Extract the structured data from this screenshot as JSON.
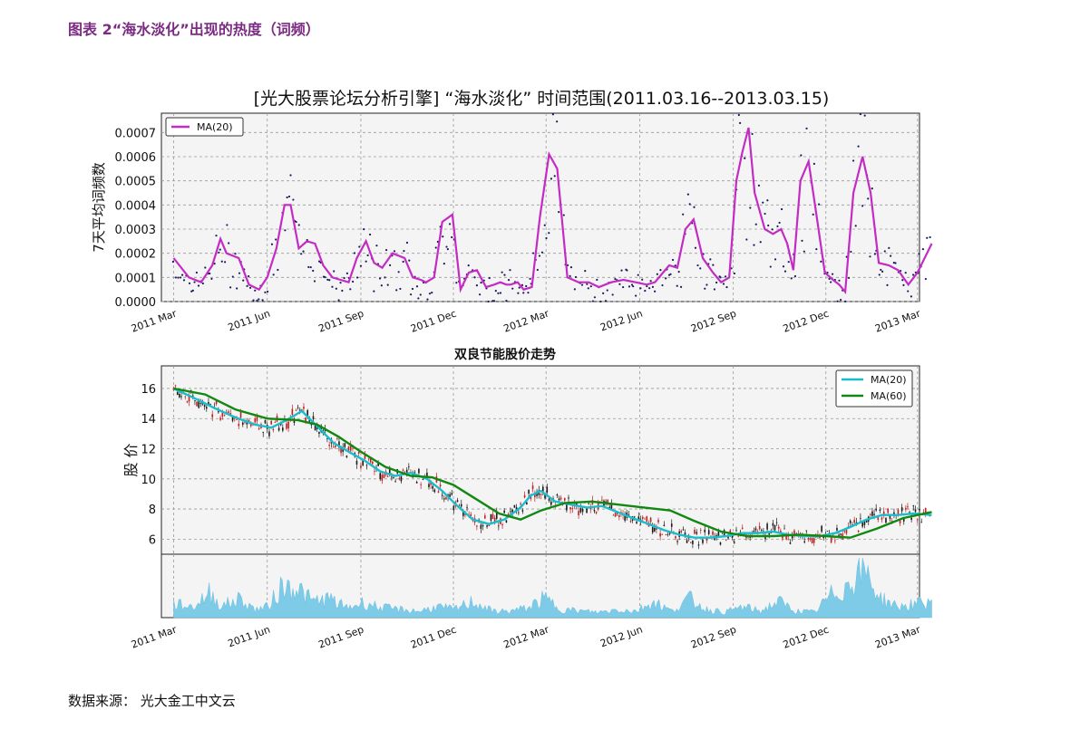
{
  "figure_title": "图表 2“海水淡化”出现的热度（词频）",
  "source": "数据来源：  光大金工中文云",
  "colors": {
    "title": "#7b2c82",
    "ma_word": "#c42bc4",
    "dots": "#1a1a5e",
    "ma20_price": "#1bbccc",
    "ma60_price": "#118811",
    "candle_up": "#c21f1f",
    "candle_down": "#1a1a1a",
    "volume": "#7ecbe8",
    "plot_bg": "#f4f4f4"
  },
  "chart_data": [
    {
      "type": "line",
      "title": "[光大股票论坛分析引擎] “海水淡化” 时间范围(2011.03.16--2013.03.15)",
      "ylabel": "7天平均词频数",
      "legend": [
        "MA(20)"
      ],
      "legend_position": "top-left",
      "grid": true,
      "x_range": [
        "2011-03-16",
        "2013-03-15"
      ],
      "x_ticks": [
        "2011 Mar",
        "2011 Jun",
        "2011 Sep",
        "2011 Dec",
        "2012 Mar",
        "2012 Jun",
        "2012 Sep",
        "2012 Dec",
        "2013 Mar"
      ],
      "y_ticks": [
        "0.0000",
        "0.0001",
        "0.0002",
        "0.0003",
        "0.0004",
        "0.0005",
        "0.0006",
        "0.0007"
      ],
      "ylim": [
        0,
        0.00078
      ],
      "series": [
        {
          "name": "MA(20)",
          "x": [
            "2011-03-01",
            "2011-03-16",
            "2011-03-28",
            "2011-04-08",
            "2011-04-16",
            "2011-04-22",
            "2011-05-04",
            "2011-05-14",
            "2011-05-24",
            "2011-06-01",
            "2011-06-10",
            "2011-06-18",
            "2011-06-24",
            "2011-07-02",
            "2011-07-10",
            "2011-07-18",
            "2011-07-26",
            "2011-08-04",
            "2011-08-12",
            "2011-08-20",
            "2011-08-28",
            "2011-09-06",
            "2011-09-14",
            "2011-09-22",
            "2011-10-02",
            "2011-10-14",
            "2011-10-22",
            "2011-10-30",
            "2011-11-04",
            "2011-11-12",
            "2011-11-20",
            "2011-11-30",
            "2011-12-08",
            "2011-12-16",
            "2011-12-24",
            "2012-01-02",
            "2012-01-10",
            "2012-01-16",
            "2012-01-22",
            "2012-01-26",
            "2012-02-02",
            "2012-02-08",
            "2012-02-16",
            "2012-02-24",
            "2012-03-04",
            "2012-03-12",
            "2012-03-22",
            "2012-04-02",
            "2012-04-12",
            "2012-04-22",
            "2012-05-04",
            "2012-05-16",
            "2012-05-28",
            "2012-06-08",
            "2012-06-16",
            "2012-06-24",
            "2012-06-30",
            "2012-07-08",
            "2012-07-16",
            "2012-07-24",
            "2012-08-02",
            "2012-08-12",
            "2012-08-20",
            "2012-08-28",
            "2012-09-04",
            "2012-09-10",
            "2012-09-16",
            "2012-09-22",
            "2012-10-02",
            "2012-10-10",
            "2012-10-18",
            "2012-10-24",
            "2012-10-30",
            "2012-11-06",
            "2012-11-14",
            "2012-11-22",
            "2012-11-30",
            "2012-12-08",
            "2012-12-14",
            "2012-12-20",
            "2012-12-28",
            "2013-01-06",
            "2013-01-14",
            "2013-01-22",
            "2013-02-01",
            "2013-02-10",
            "2013-02-20",
            "2013-03-01",
            "2013-03-15"
          ],
          "y": [
            0.00018,
            0.0001,
            8e-05,
            0.00015,
            0.00026,
            0.0002,
            0.00018,
            7e-05,
            5e-05,
            0.0001,
            0.00022,
            0.0004,
            0.0004,
            0.00022,
            0.00025,
            0.00024,
            0.00015,
            0.0001,
            9e-05,
            8e-05,
            0.00018,
            0.00025,
            0.00016,
            0.00014,
            0.0002,
            0.00018,
            0.0001,
            9e-05,
            8e-05,
            0.0001,
            0.00033,
            0.00036,
            5e-05,
            0.00012,
            0.00013,
            6e-05,
            7e-05,
            8e-05,
            7e-05,
            7e-05,
            8e-05,
            5e-05,
            6e-05,
            0.00035,
            0.00061,
            0.00055,
            0.0001,
            8e-05,
            8e-05,
            6e-05,
            8e-05,
            9e-05,
            8e-05,
            7e-05,
            8e-05,
            0.00012,
            0.00015,
            0.00014,
            0.0003,
            0.00034,
            0.00018,
            0.00012,
            8e-05,
            0.0001,
            0.0005,
            0.00062,
            0.00072,
            0.00045,
            0.0003,
            0.00028,
            0.0003,
            0.00024,
            0.00013,
            0.0005,
            0.00058,
            0.00035,
            0.00012,
            9e-05,
            7e-05,
            4e-05,
            0.00045,
            0.0006,
            0.00045,
            0.00016,
            0.00015,
            0.00013,
            7e-05,
            0.00012,
            0.00024
          ]
        }
      ]
    },
    {
      "type": "line",
      "title": "双良节能股价走势",
      "ylabel": "股 价",
      "legend": [
        "MA(20)",
        "MA(60)"
      ],
      "legend_position": "top-right",
      "grid": true,
      "x_range": [
        "2011-03-16",
        "2013-03-15"
      ],
      "x_ticks": [
        "2011 Mar",
        "2011 Jun",
        "2011 Sep",
        "2011 Dec",
        "2012 Mar",
        "2012 Jun",
        "2012 Sep",
        "2012 Dec",
        "2013 Mar"
      ],
      "y_ticks": [
        "6",
        "8",
        "10",
        "12",
        "14",
        "16"
      ],
      "ylim": [
        5,
        17.5
      ],
      "series": [
        {
          "name": "MA(20)",
          "x": [
            "2011-03-01",
            "2011-03-20",
            "2011-04-10",
            "2011-04-30",
            "2011-05-20",
            "2011-06-05",
            "2011-06-20",
            "2011-07-05",
            "2011-07-20",
            "2011-08-05",
            "2011-08-20",
            "2011-09-05",
            "2011-09-20",
            "2011-10-05",
            "2011-10-20",
            "2011-11-05",
            "2011-11-20",
            "2011-12-05",
            "2011-12-20",
            "2012-01-05",
            "2012-01-20",
            "2012-02-05",
            "2012-02-15",
            "2012-02-25",
            "2012-03-10",
            "2012-03-25",
            "2012-04-10",
            "2012-04-25",
            "2012-05-10",
            "2012-05-25",
            "2012-06-10",
            "2012-06-25",
            "2012-07-10",
            "2012-07-25",
            "2012-08-10",
            "2012-08-25",
            "2012-09-10",
            "2012-09-25",
            "2012-10-10",
            "2012-10-25",
            "2012-11-10",
            "2012-11-25",
            "2012-12-10",
            "2012-12-25",
            "2013-01-10",
            "2013-01-25",
            "2013-02-10",
            "2013-02-25",
            "2013-03-15"
          ],
          "y": [
            16,
            15.4,
            14.7,
            14.1,
            13.6,
            13.4,
            13.9,
            14.5,
            13.5,
            12.4,
            11.8,
            11.2,
            10.5,
            10.2,
            10.4,
            10,
            9.2,
            8.2,
            7.3,
            7,
            7.3,
            8.1,
            8.9,
            9.2,
            8.5,
            8.3,
            8.1,
            8.2,
            7.8,
            7.4,
            7,
            6.6,
            6.3,
            6.1,
            6.1,
            6.2,
            6.4,
            6.4,
            6.5,
            6.3,
            6.2,
            6.2,
            6.4,
            6.8,
            7.3,
            7.6,
            7.6,
            7.7,
            7.6
          ]
        },
        {
          "name": "MA(60)",
          "x": [
            "2011-03-01",
            "2011-04-01",
            "2011-05-01",
            "2011-06-01",
            "2011-07-01",
            "2011-07-20",
            "2011-08-10",
            "2011-09-01",
            "2011-09-25",
            "2011-10-20",
            "2011-11-10",
            "2011-12-01",
            "2011-12-20",
            "2012-01-15",
            "2012-02-05",
            "2012-02-25",
            "2012-03-20",
            "2012-04-15",
            "2012-05-10",
            "2012-06-05",
            "2012-07-01",
            "2012-07-25",
            "2012-08-20",
            "2012-09-15",
            "2012-10-10",
            "2012-11-05",
            "2012-12-01",
            "2012-12-25",
            "2013-01-20",
            "2013-02-15",
            "2013-03-15"
          ],
          "y": [
            16,
            15.6,
            14.6,
            14,
            13.9,
            13.6,
            12.8,
            11.8,
            10.8,
            10.2,
            10.1,
            9.6,
            8.8,
            7.7,
            7.3,
            7.9,
            8.4,
            8.5,
            8.3,
            8.1,
            7.9,
            7.2,
            6.5,
            6.2,
            6.2,
            6.3,
            6.2,
            6.1,
            6.7,
            7.4,
            7.8
          ]
        }
      ]
    },
    {
      "type": "area",
      "title": "",
      "name": "volume",
      "grid": true,
      "x_range": [
        "2011-03-16",
        "2013-03-15"
      ],
      "x_ticks": [
        "2011 Mar",
        "2011 Jun",
        "2011 Sep",
        "2011 Dec",
        "2012 Mar",
        "2012 Jun",
        "2012 Sep",
        "2012 Dec",
        "2013 Mar"
      ],
      "ylim": [
        0,
        1
      ],
      "x": [
        "2011-03-01",
        "2011-03-20",
        "2011-04-05",
        "2011-04-18",
        "2011-05-05",
        "2011-05-20",
        "2011-06-02",
        "2011-06-14",
        "2011-06-28",
        "2011-07-15",
        "2011-08-01",
        "2011-08-18",
        "2011-09-04",
        "2011-09-22",
        "2011-10-10",
        "2011-10-28",
        "2011-11-15",
        "2011-12-02",
        "2011-12-20",
        "2012-01-08",
        "2012-01-25",
        "2012-02-12",
        "2012-02-28",
        "2012-03-18",
        "2012-04-05",
        "2012-04-22",
        "2012-05-10",
        "2012-05-28",
        "2012-06-15",
        "2012-07-02",
        "2012-07-20",
        "2012-08-06",
        "2012-08-24",
        "2012-09-10",
        "2012-09-28",
        "2012-10-15",
        "2012-11-02",
        "2012-11-20",
        "2012-12-08",
        "2012-12-20",
        "2013-01-06",
        "2013-01-24",
        "2013-02-10",
        "2013-02-28",
        "2013-03-15"
      ],
      "values": [
        0.25,
        0.2,
        0.45,
        0.22,
        0.35,
        0.15,
        0.2,
        0.55,
        0.6,
        0.3,
        0.35,
        0.18,
        0.28,
        0.18,
        0.15,
        0.12,
        0.2,
        0.15,
        0.3,
        0.12,
        0.12,
        0.18,
        0.35,
        0.15,
        0.12,
        0.1,
        0.15,
        0.12,
        0.3,
        0.12,
        0.35,
        0.15,
        0.1,
        0.2,
        0.12,
        0.3,
        0.12,
        0.1,
        0.45,
        0.55,
        0.95,
        0.35,
        0.2,
        0.25,
        0.3
      ]
    }
  ]
}
